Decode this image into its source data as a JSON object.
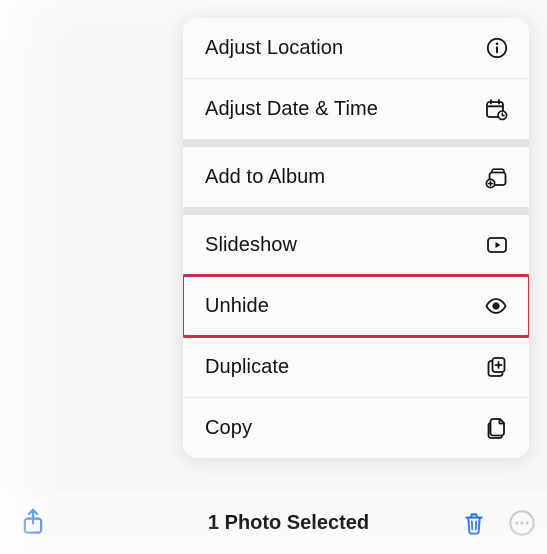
{
  "menu": {
    "groups": [
      {
        "items": [
          {
            "key": "adjust-location",
            "label": "Adjust Location",
            "icon": "info-icon"
          },
          {
            "key": "adjust-date-time",
            "label": "Adjust Date & Time",
            "icon": "calendar-clock-icon"
          }
        ]
      },
      {
        "items": [
          {
            "key": "add-to-album",
            "label": "Add to Album",
            "icon": "album-add-icon"
          }
        ]
      },
      {
        "items": [
          {
            "key": "slideshow",
            "label": "Slideshow",
            "icon": "play-rect-icon"
          },
          {
            "key": "unhide",
            "label": "Unhide",
            "icon": "eye-icon",
            "highlighted": true
          },
          {
            "key": "duplicate",
            "label": "Duplicate",
            "icon": "duplicate-icon"
          },
          {
            "key": "copy",
            "label": "Copy",
            "icon": "copy-icon"
          }
        ]
      }
    ]
  },
  "toolbar": {
    "status": "1 Photo Selected"
  },
  "colors": {
    "accent": "#1f6ef0",
    "highlight": "#c9333f",
    "disabled": "#c9c9ce"
  }
}
